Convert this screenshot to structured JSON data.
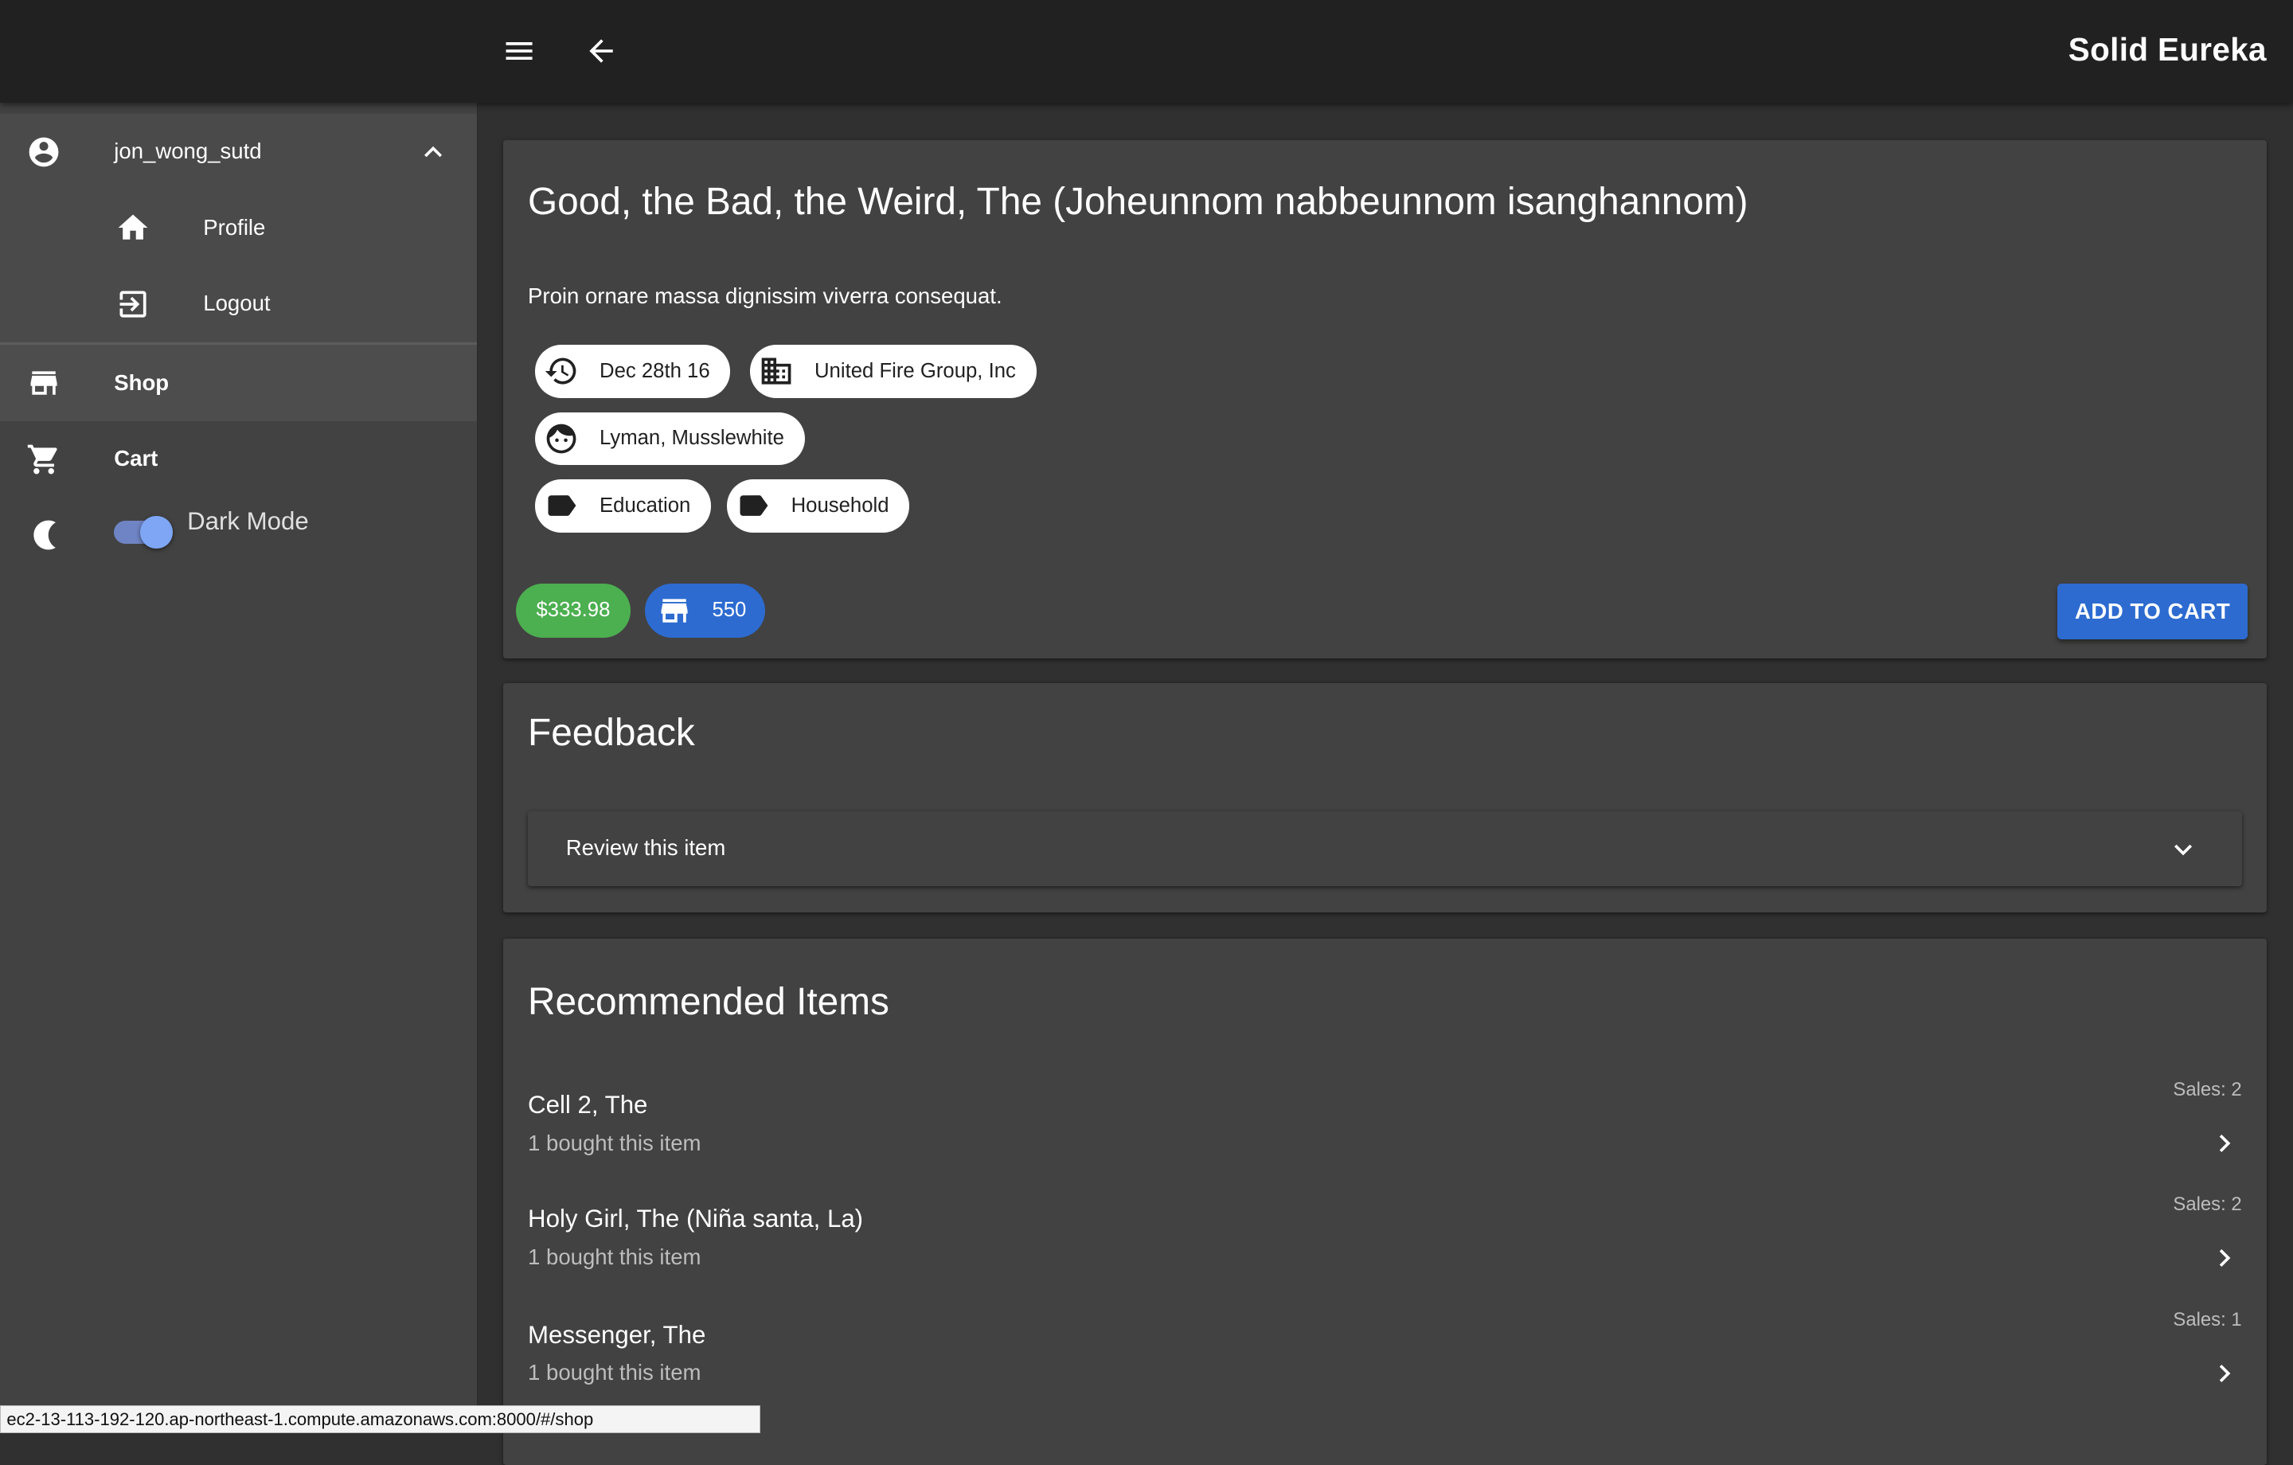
{
  "app": {
    "title": "Solid Eureka"
  },
  "drawer": {
    "username": "jon_wong_sutd",
    "profile_label": "Profile",
    "logout_label": "Logout",
    "shop_label": "Shop",
    "cart_label": "Cart",
    "dark_mode_label": "Dark Mode",
    "dark_mode_on": true
  },
  "product": {
    "title": "Good, the Bad, the Weird, The (Joheunnom nabbeunnom isanghannom)",
    "description": "Proin ornare massa dignissim viverra consequat.",
    "date": "Dec 28th 16",
    "company": "United Fire Group, Inc",
    "people": "Lyman, Musslewhite",
    "tags": [
      "Education",
      "Household"
    ],
    "price": "$333.98",
    "stock": "550",
    "add_to_cart_label": "ADD TO CART"
  },
  "feedback": {
    "title": "Feedback",
    "review_label": "Review this item"
  },
  "recommended": {
    "title": "Recommended Items",
    "items": [
      {
        "name": "Cell 2, The",
        "bought": "1 bought this item",
        "sales": "Sales: 2"
      },
      {
        "name": "Holy Girl, The (Niña santa, La)",
        "bought": "1 bought this item",
        "sales": "Sales: 2"
      },
      {
        "name": "Messenger, The",
        "bought": "1 bought this item",
        "sales": "Sales: 1"
      }
    ]
  },
  "statusbar": {
    "url": "ec2-13-113-192-120.ap-northeast-1.compute.amazonaws.com:8000/#/shop"
  },
  "colors": {
    "price_chip": "#4caf50",
    "accent_blue": "#2d6bd0",
    "toggle": "#7ea6f5"
  }
}
